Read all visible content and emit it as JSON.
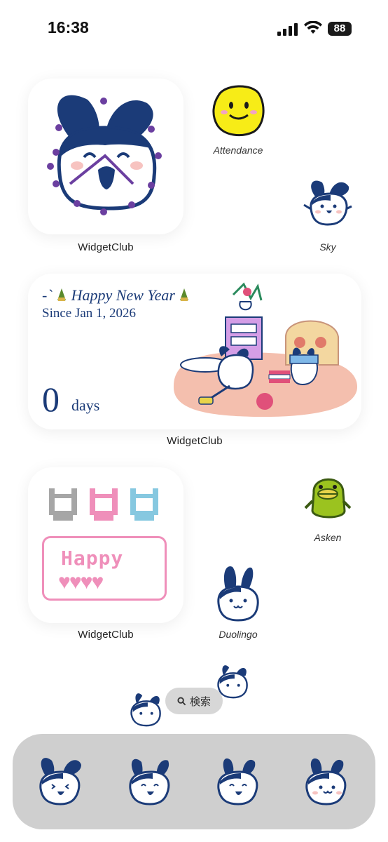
{
  "status_bar": {
    "time": "16:38",
    "battery": "88"
  },
  "widgets": {
    "top_widget_label": "WidgetClub",
    "newyear": {
      "title": "Happy New Year",
      "since": "Since Jan 1, 2026",
      "count": "0",
      "unit": "days",
      "label": "WidgetClub"
    },
    "pixel_widget": {
      "happy_text": "Happy",
      "label": "WidgetClub"
    }
  },
  "apps": [
    {
      "name": "Attendance"
    },
    {
      "name": "Sky"
    },
    {
      "name": "Asken"
    },
    {
      "name": "Duolingo"
    }
  ],
  "search": {
    "label": "検索"
  },
  "colors": {
    "navy": "#1b3b78",
    "pink": "#f3a3c7",
    "yellow": "#f7ec17",
    "green": "#9bc31f"
  }
}
